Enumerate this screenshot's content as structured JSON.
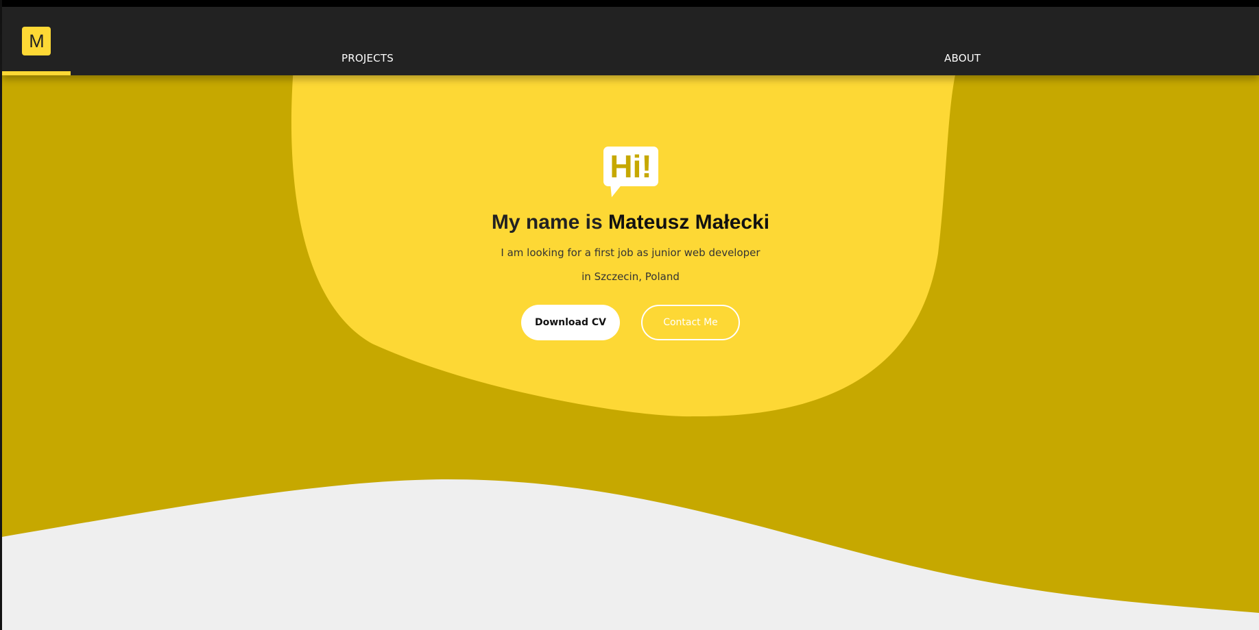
{
  "colors": {
    "accent_yellow": "#fdd835",
    "mustard_background": "#c6a800",
    "navbar": "#222222",
    "light_section": "#efefef"
  },
  "navbar": {
    "logo_text": "M",
    "links": [
      {
        "label": "PROJECTS"
      },
      {
        "label": "ABOUT"
      }
    ]
  },
  "hero": {
    "icon": "hi-speech-bubble-icon",
    "icon_text": "Hi!",
    "title_prefix": "My name is",
    "title_name": "Mateusz Małecki",
    "subtitle_line1": "I am looking for a first job as junior web developer",
    "subtitle_line2": "in Szczecin, Poland",
    "download_cv_label": "Download CV",
    "contact_me_label": "Contact Me"
  }
}
